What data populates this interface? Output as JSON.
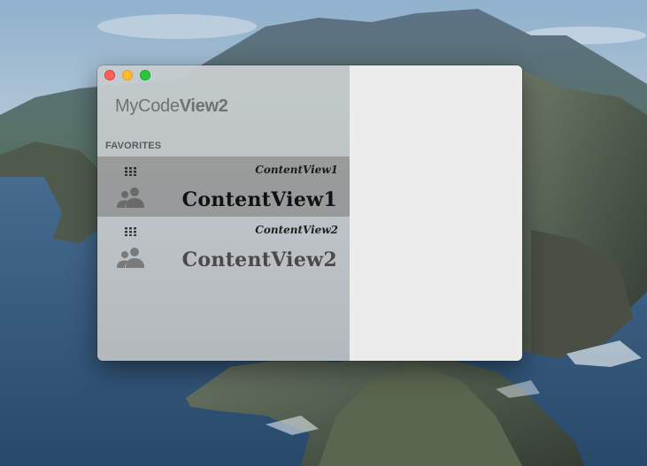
{
  "window": {
    "traffic_lights": {
      "close_color": "#fe5f57",
      "minimize_color": "#febc2e",
      "zoom_color": "#28c840"
    }
  },
  "sidebar": {
    "title_prefix": "MyCode",
    "title_bold": "View2",
    "section_header": "FAVORITES",
    "items": [
      {
        "small_label": "ContentView1",
        "label": "ContentView1",
        "selected": true,
        "small_icon": "grid-icon",
        "icon": "people-icon"
      },
      {
        "small_label": "ContentView2",
        "label": "ContentView2",
        "selected": false,
        "small_icon": "grid-icon",
        "icon": "people-icon"
      }
    ]
  },
  "colors": {
    "sidebar_bg": "#c4c8ca",
    "content_bg": "#ececec",
    "selection_bg": "#8a8b87"
  }
}
